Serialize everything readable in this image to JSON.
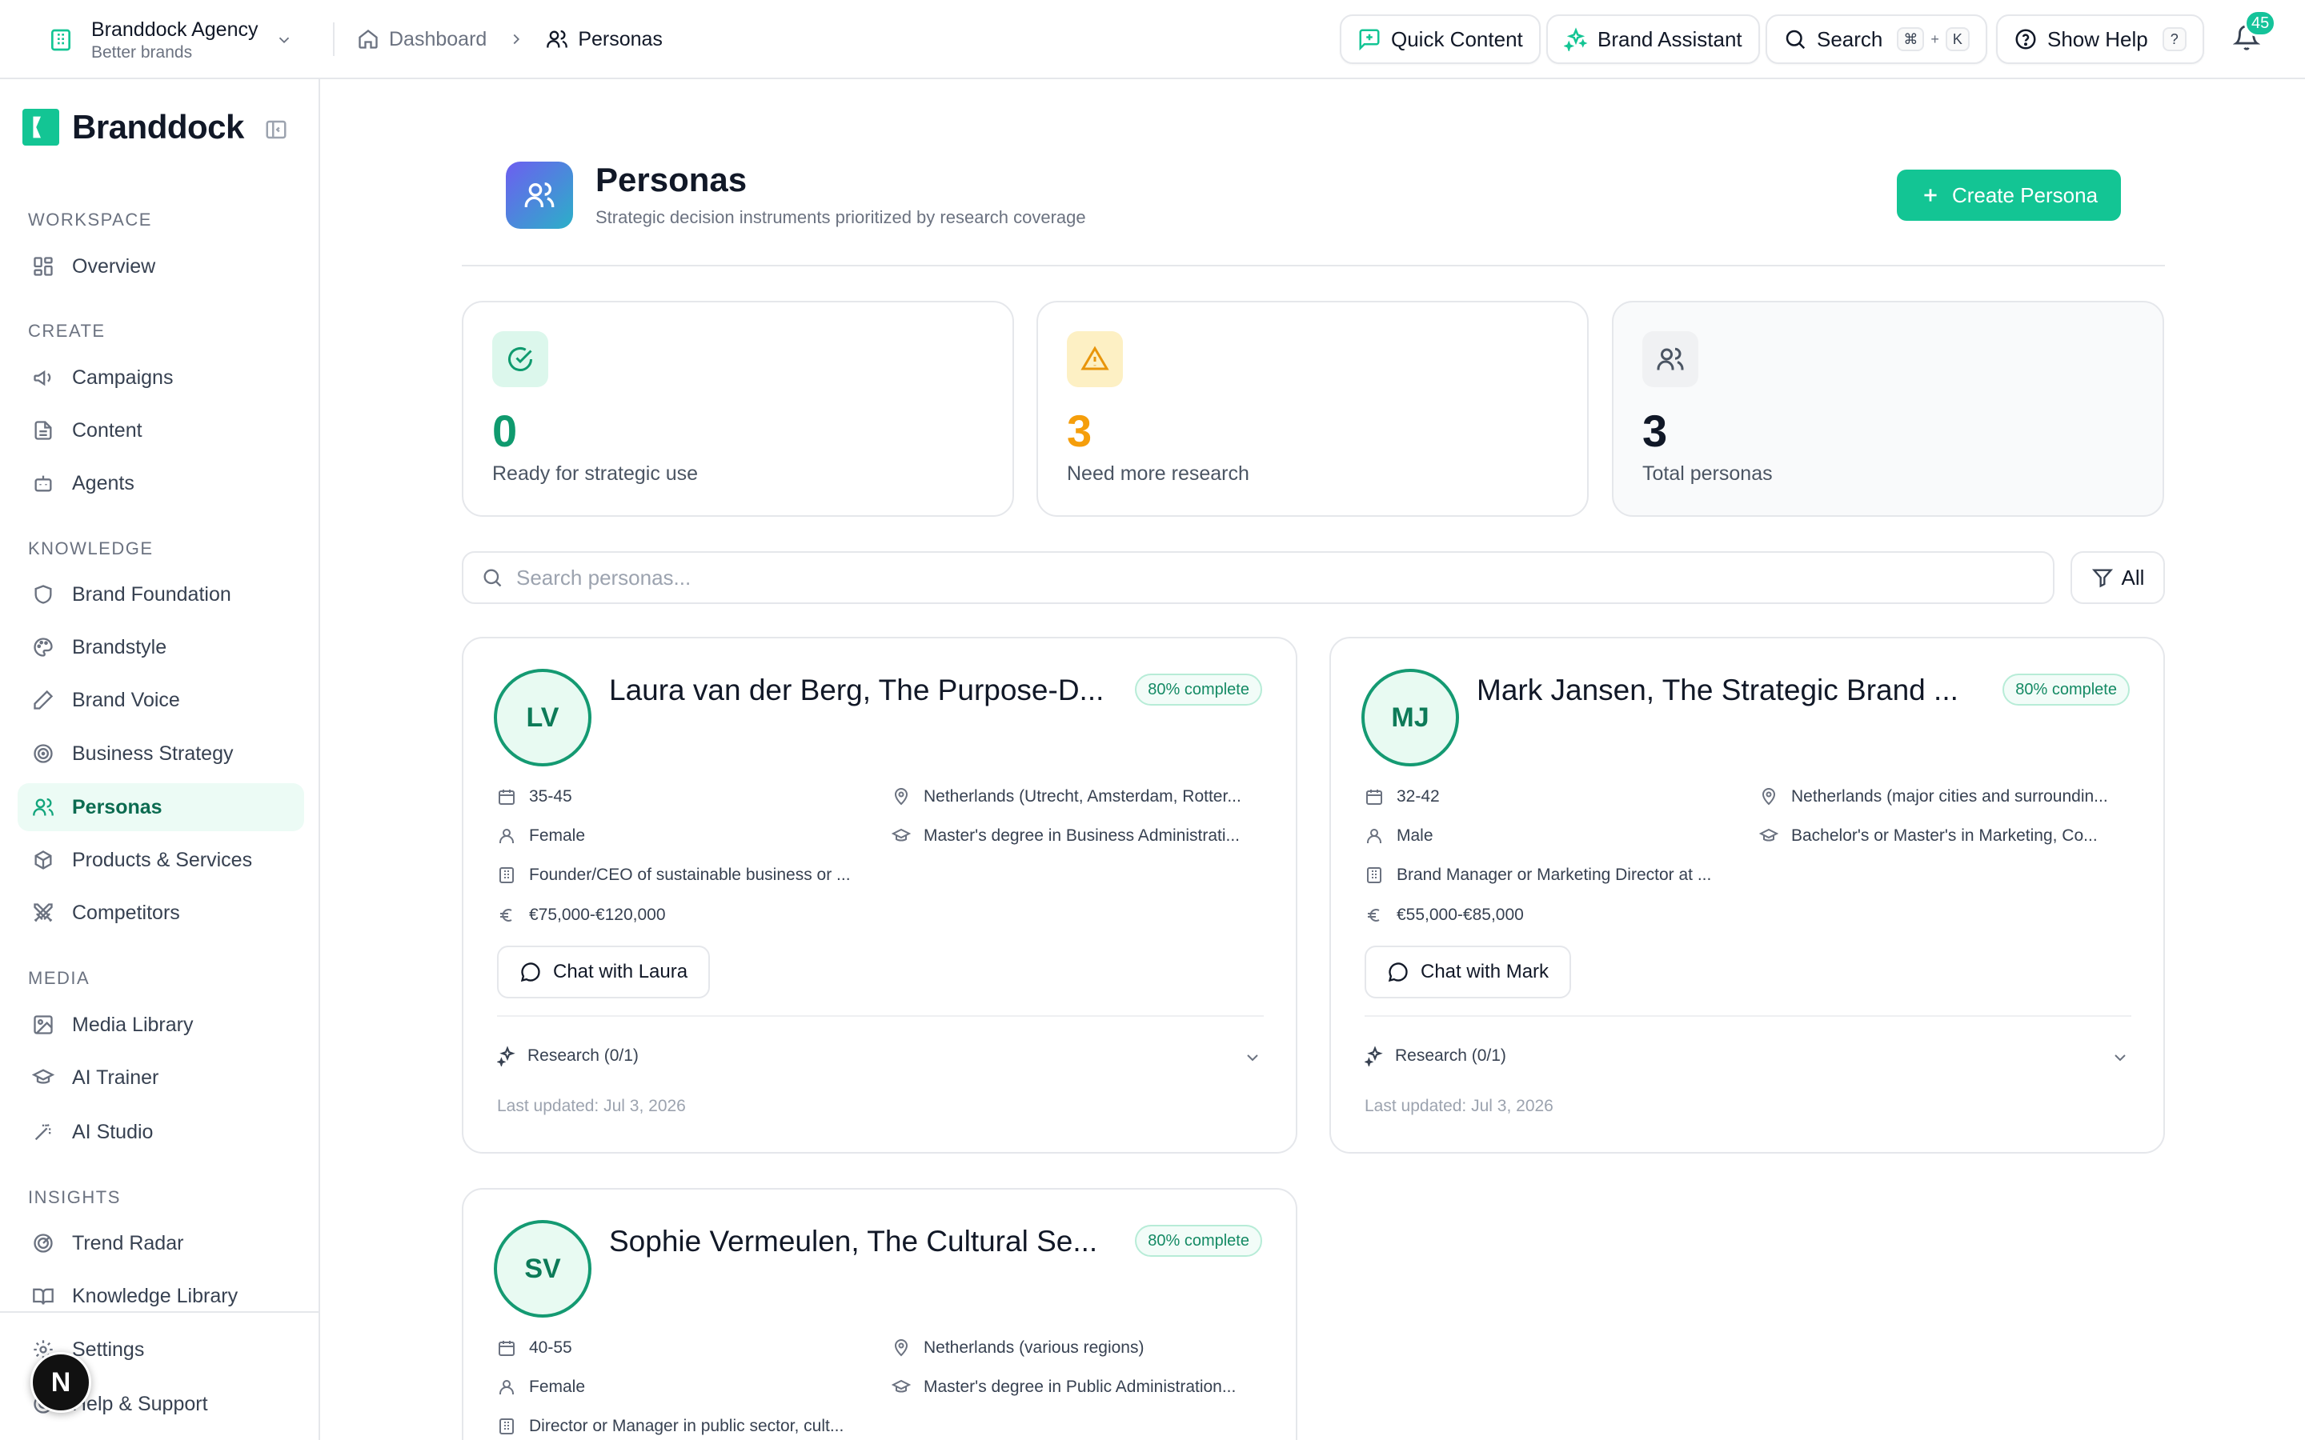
{
  "workspace": {
    "name": "Branddock Agency",
    "subtitle": "Better brands"
  },
  "breadcrumb": {
    "home": "Dashboard",
    "current": "Personas"
  },
  "topbar": {
    "quick_content": "Quick Content",
    "brand_assistant": "Brand Assistant",
    "search": "Search",
    "search_key_1": "⌘",
    "search_key_plus": "+",
    "search_key_2": "K",
    "help": "Show Help",
    "help_key": "?",
    "notifications_count": "45"
  },
  "sidebar": {
    "brand": "Branddock",
    "sections": {
      "workspace": "WORKSPACE",
      "create": "CREATE",
      "knowledge": "KNOWLEDGE",
      "media": "MEDIA",
      "insights": "INSIGHTS"
    },
    "items": {
      "overview": "Overview",
      "campaigns": "Campaigns",
      "content": "Content",
      "agents": "Agents",
      "brand_foundation": "Brand Foundation",
      "brandstyle": "Brandstyle",
      "brand_voice": "Brand Voice",
      "business_strategy": "Business Strategy",
      "personas": "Personas",
      "products_services": "Products & Services",
      "competitors": "Competitors",
      "media_library": "Media Library",
      "ai_trainer": "AI Trainer",
      "ai_studio": "AI Studio",
      "trend_radar": "Trend Radar",
      "knowledge_library": "Knowledge Library",
      "settings": "Settings",
      "help_support": "Help & Support"
    },
    "dev_badge": "N"
  },
  "page": {
    "title": "Personas",
    "subtitle": "Strategic decision instruments prioritized by research coverage",
    "create_button": "Create Persona"
  },
  "stats": [
    {
      "value": "0",
      "label": "Ready for strategic use",
      "color": "#0f9a6e"
    },
    {
      "value": "3",
      "label": "Need more research",
      "color": "#f59e0b"
    },
    {
      "value": "3",
      "label": "Total personas",
      "color": "#111827"
    }
  ],
  "search": {
    "placeholder": "Search personas...",
    "value": ""
  },
  "filter": {
    "label": "All"
  },
  "personas": [
    {
      "initials": "LV",
      "name": "Laura van der Berg, The Purpose-D...",
      "completion": "80% complete",
      "age": "35-45",
      "gender": "Female",
      "occupation": "Founder/CEO of sustainable business or ...",
      "income": "€75,000-€120,000",
      "location": "Netherlands (Utrecht, Amsterdam, Rotter...",
      "education": "Master's degree in Business Administrati...",
      "chat": "Chat with Laura",
      "research": "Research (0/1)",
      "updated": "Last updated: Jul 3, 2026"
    },
    {
      "initials": "MJ",
      "name": "Mark Jansen, The Strategic Brand ...",
      "completion": "80% complete",
      "age": "32-42",
      "gender": "Male",
      "occupation": "Brand Manager or Marketing Director at ...",
      "income": "€55,000-€85,000",
      "location": "Netherlands (major cities and surroundin...",
      "education": "Bachelor's or Master's in Marketing, Co...",
      "chat": "Chat with Mark",
      "research": "Research (0/1)",
      "updated": "Last updated: Jul 3, 2026"
    },
    {
      "initials": "SV",
      "name": "Sophie Vermeulen, The Cultural Se...",
      "completion": "80% complete",
      "age": "40-55",
      "gender": "Female",
      "occupation": "Director or Manager in public sector, cult...",
      "location": "Netherlands (various regions)",
      "education": "Master's degree in Public Administration..."
    }
  ],
  "colors": {
    "accent": "#13c594",
    "active_bg": "#ecfbf5",
    "avatar_border": "#149a72"
  }
}
